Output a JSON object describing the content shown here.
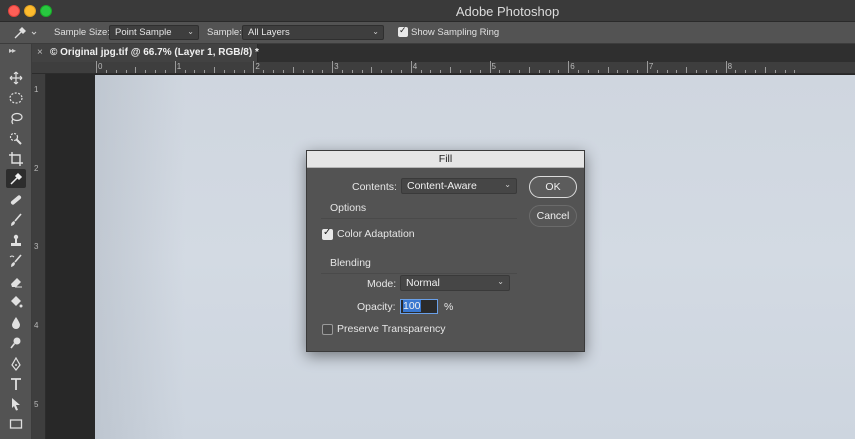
{
  "window": {
    "title": "Adobe Photoshop"
  },
  "options_bar": {
    "sample_size_label": "Sample Size:",
    "sample_size_value": "Point Sample",
    "sample_label": "Sample:",
    "sample_value": "All Layers",
    "show_sampling_ring_label": "Show Sampling Ring",
    "show_sampling_ring_checked": true
  },
  "document_tab": {
    "close": "×",
    "title": "© Original jpg.tif @ 66.7% (Layer 1, RGB/8) *"
  },
  "ruler": {
    "top_numbers": [
      "0",
      "1",
      "2",
      "3",
      "4",
      "5",
      "6",
      "7",
      "8"
    ],
    "left_numbers": [
      "1",
      "2",
      "3",
      "4",
      "5"
    ]
  },
  "toolbar": {
    "active_tool": "eyedropper-tool",
    "tools": [
      "move-tool",
      "marquee-tool",
      "lasso-tool",
      "quick-selection-tool",
      "crop-tool",
      "eyedropper-tool",
      "healing-brush-tool",
      "brush-tool",
      "clone-stamp-tool",
      "history-brush-tool",
      "eraser-tool",
      "paint-bucket-tool",
      "blur-tool",
      "dodge-tool",
      "pen-tool",
      "type-tool",
      "path-selection-tool",
      "rectangle-tool"
    ]
  },
  "fill_dialog": {
    "title": "Fill",
    "contents_label": "Contents:",
    "contents_value": "Content-Aware",
    "options_heading": "Options",
    "color_adaptation_label": "Color Adaptation",
    "color_adaptation_checked": true,
    "blending_heading": "Blending",
    "mode_label": "Mode:",
    "mode_value": "Normal",
    "opacity_label": "Opacity:",
    "opacity_value": "100",
    "opacity_unit": "%",
    "preserve_transparency_label": "Preserve Transparency",
    "preserve_transparency_checked": false,
    "ok_label": "OK",
    "cancel_label": "Cancel"
  },
  "colors": {
    "ui_panel": "#535353",
    "ui_dark": "#2b2b2b",
    "canvas": "#d1d8e1",
    "selection_highlight": "#3a78d0"
  }
}
